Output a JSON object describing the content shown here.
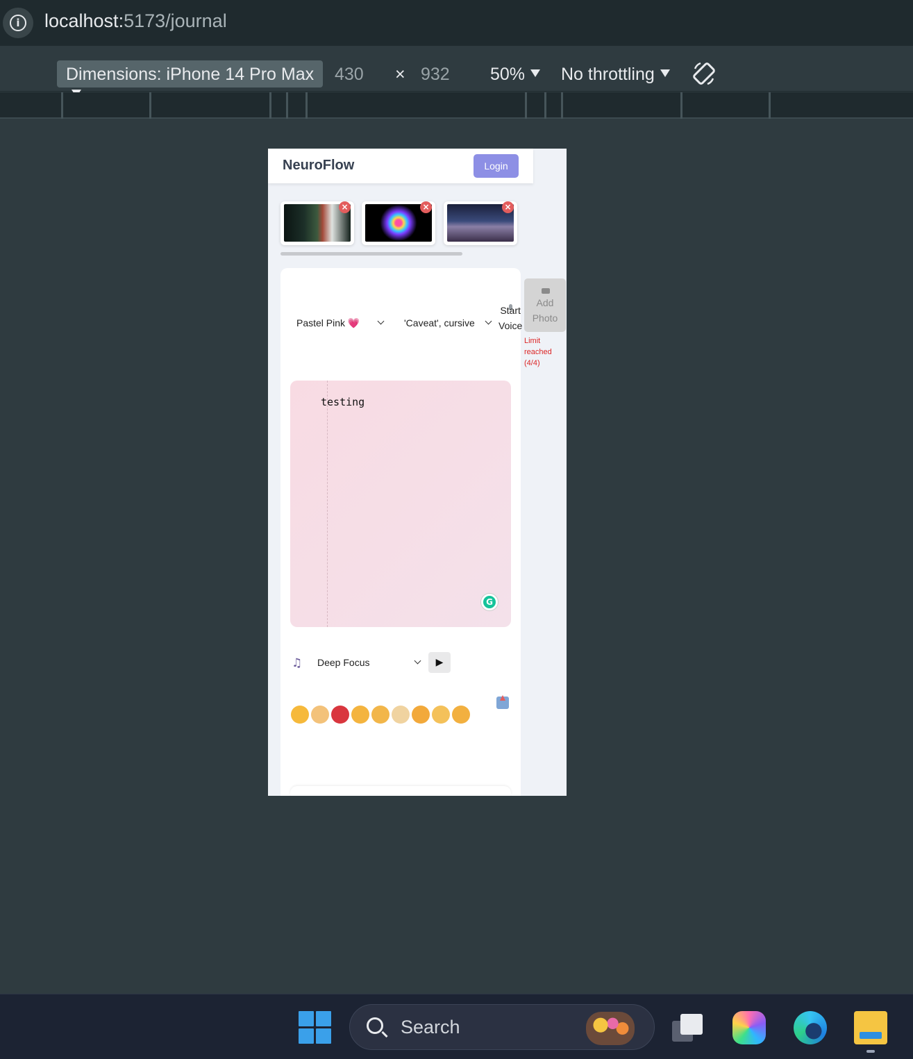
{
  "browser": {
    "url_host": "localhost:",
    "url_path": "5173/journal"
  },
  "devtools": {
    "device_label": "Dimensions: iPhone 14 Pro Max",
    "width_value": "430",
    "times_symbol": "×",
    "height_value": "932",
    "zoom_label": "50%",
    "throttling_label": "No throttling"
  },
  "app": {
    "brand": "NeuroFlow",
    "login_label": "Login",
    "photos": [
      {
        "name": "photo-1",
        "remove_label": "×"
      },
      {
        "name": "photo-2",
        "remove_label": "×"
      },
      {
        "name": "photo-3",
        "remove_label": "×"
      }
    ],
    "theme_select": "Pastel Pink 💗",
    "font_select": "'Caveat', cursive",
    "voice_label_1": "Start",
    "voice_label_2": "Voice",
    "add_photo_1": "Add",
    "add_photo_2": "Photo",
    "limit_1": "Limit",
    "limit_2": "reached",
    "limit_3": "(4/4)",
    "editor_text": "testing",
    "grammarly_label": "G",
    "music_icon": "♫",
    "music_select": "Deep Focus",
    "play_icon": "▶",
    "moods": [
      {
        "name": "smiling",
        "color": "#f6b93b"
      },
      {
        "name": "flushed",
        "color": "#f3c27a"
      },
      {
        "name": "angry",
        "color": "#d9363e"
      },
      {
        "name": "laughing",
        "color": "#f4b43f"
      },
      {
        "name": "sleepy",
        "color": "#f2b64a"
      },
      {
        "name": "shocked",
        "color": "#f0d3a0"
      },
      {
        "name": "heart-eyes",
        "color": "#f2a93b"
      },
      {
        "name": "nerd",
        "color": "#f4c15a"
      },
      {
        "name": "party",
        "color": "#f2b040"
      }
    ]
  },
  "taskbar": {
    "search_label": "Search"
  }
}
